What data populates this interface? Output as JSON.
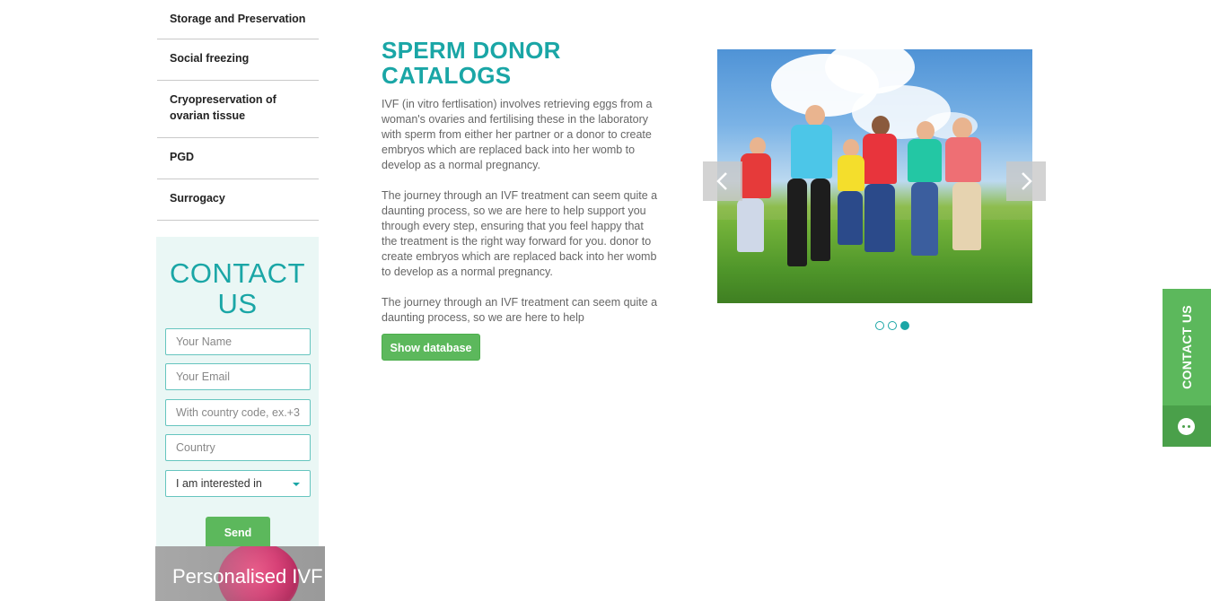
{
  "sidebar": {
    "items": [
      {
        "label": "Storage and Preservation"
      },
      {
        "label": "Social freezing"
      },
      {
        "label": "Cryopreservation of ovarian tissue"
      },
      {
        "label": "PGD"
      },
      {
        "label": "Surrogacy"
      }
    ]
  },
  "contact_form": {
    "title": "CONTACT US",
    "name_placeholder": "Your Name",
    "email_placeholder": "Your Email",
    "phone_placeholder": "With country code, ex.+3",
    "country_placeholder": "Country",
    "interest_selected": "I am interested in",
    "send_label": "Send"
  },
  "promo": {
    "text": "Personalised IVF and E"
  },
  "main": {
    "title": "SPERM DONOR CATALOGS",
    "paragraph_1": "IVF (in vitro fertlisation) involves retrieving eggs from a woman's ovaries and fertilising these in the laboratory with sperm from either her partner or a donor to create embryos which are replaced back into her womb to develop as a normal pregnancy.",
    "paragraph_2": "The journey through an IVF treatment can seem quite a daunting process, so we are here to help support you through every step, ensuring that you feel happy that the treatment is the right way forward for you. donor to create embryos which are replaced back into her womb to develop as a normal pregnancy.",
    "paragraph_3": "The journey through an IVF treatment can seem quite a daunting process, so we are here to help",
    "show_button": "Show database"
  },
  "slider": {
    "slide_count": 3,
    "active_slide": 3,
    "prev_icon": "chevron-left-icon",
    "next_icon": "chevron-right-icon"
  },
  "side_tab": {
    "label": "CONTACT US",
    "icon": "chat-icon"
  },
  "colors": {
    "accent": "#1aa6a6",
    "button_green": "#5cb85c",
    "form_bg": "#eaf7f5"
  }
}
